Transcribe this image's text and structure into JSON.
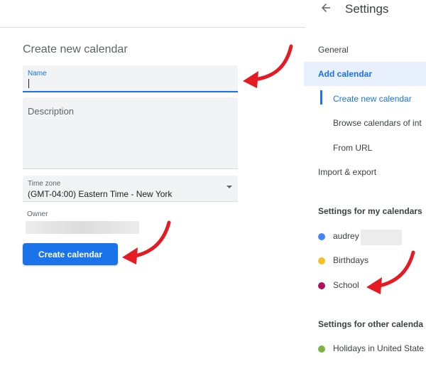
{
  "form": {
    "title": "Create new calendar",
    "name_label": "Name",
    "name_value": "",
    "description_placeholder": "Description",
    "timezone_label": "Time zone",
    "timezone_value": "(GMT-04:00) Eastern Time - New York",
    "owner_label": "Owner",
    "create_button": "Create calendar"
  },
  "header": {
    "title": "Settings",
    "back_icon": "arrow-back-icon"
  },
  "nav": {
    "general": "General",
    "add_calendar": "Add calendar",
    "create_new": "Create new calendar",
    "browse": "Browse calendars of int",
    "from_url": "From URL",
    "import_export": "Import & export"
  },
  "my_calendars": {
    "title": "Settings for my calendars",
    "items": [
      {
        "label": "audrey",
        "color": "#4285f4"
      },
      {
        "label": "Birthdays",
        "color": "#f6bf26"
      },
      {
        "label": "School",
        "color": "#ad1457"
      }
    ]
  },
  "other_calendars": {
    "title": "Settings for other calenda",
    "items": [
      {
        "label": "Holidays in United State",
        "color": "#7cb342"
      }
    ]
  },
  "colors": {
    "accent": "#1a73e8",
    "annotation_arrow": "#e41b23"
  }
}
